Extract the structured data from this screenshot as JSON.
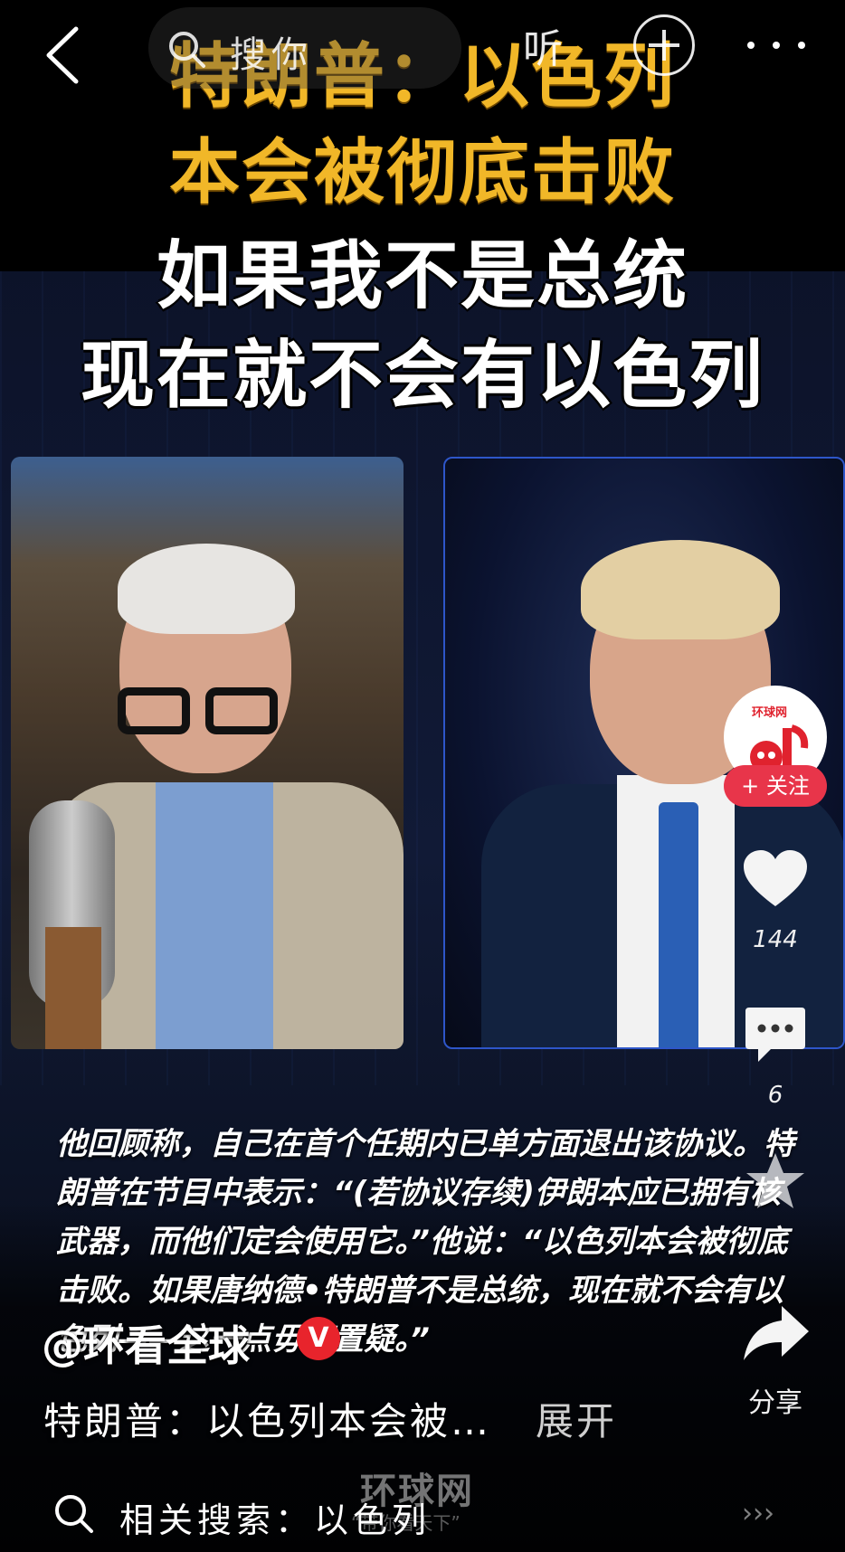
{
  "nav": {
    "search_label": "搜你",
    "listen_label": "听"
  },
  "headline": {
    "line1": "特朗普：以色列",
    "line2": "本会被彻底击败",
    "line3": "如果我不是总统",
    "line4": "现在就不会有以色列"
  },
  "description": "他回顾称，自己在首个任期内已单方面退出该协议。特朗普在节目中表示：“(若协议存续)伊朗本应已拥有核武器，而他们定会使用它。”他说：“以色列本会被彻底击败。如果唐纳德•特朗普不是总统，现在就不会有以色列——这一点毋庸置疑。”",
  "actions": {
    "avatar_label": "环球网",
    "follow_label": "+ 关注",
    "like_count": "144",
    "comment_count": "6",
    "share_label": "分享"
  },
  "post": {
    "author": "@环看全球",
    "verified_badge": "V",
    "caption": "特朗普：以色列本会被…",
    "expand_label": "展开"
  },
  "watermark": {
    "brand": "环球网",
    "slogan": "“带你看天下”"
  },
  "related_search": {
    "label": "相关搜索：以色列"
  },
  "colors": {
    "headline_yellow": "#f1b728",
    "follow_red": "#e8354a",
    "verified_red": "#e8242c"
  }
}
